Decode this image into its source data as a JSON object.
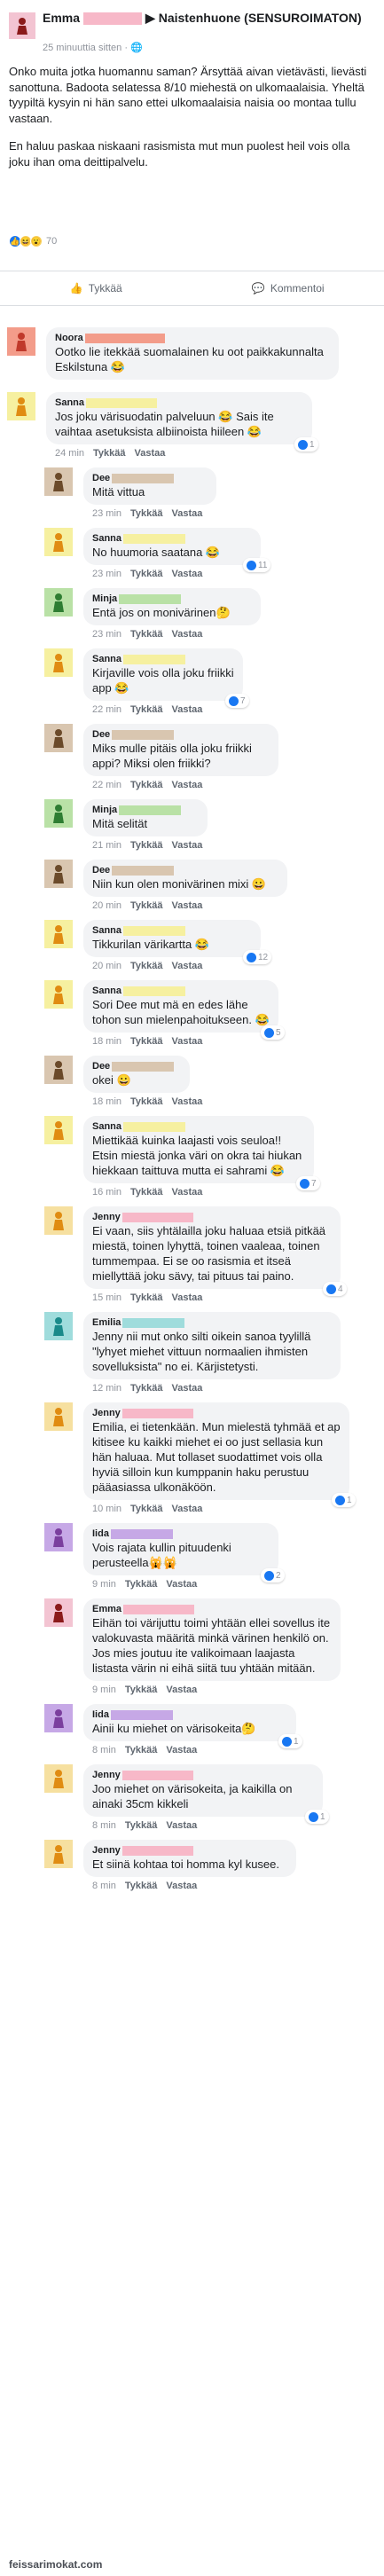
{
  "post": {
    "author": "Emma",
    "group": "Naistenhuone (SENSUROIMATON)",
    "time": "25 minuuttia sitten",
    "paragraphs": [
      "Onko muita jotka huomannu saman? Ärsyttää aivan vietävästi, lievästi sanottuna. Badoota selatessa 8/10 miehestä on ulkomaalaisia. Yheltä tyypiltä kysyin ni hän sano ettei ulkomaalaisia naisia oo montaa tullu vastaan.",
      "En haluu paskaa niskaani rasismista mut mun puolest heil vois olla joku ihan oma deittipalvelu."
    ],
    "reaction_count": "70",
    "like_label": "Tykkää",
    "comment_label": "Kommentoi"
  },
  "meta_like": "Tykkää",
  "meta_reply": "Vastaa",
  "comments": [
    {
      "name": "Noora",
      "text": "Ootko lie itekkää suomalainen ku oot paikkakunnalta Eskilstuna 😂",
      "time": "",
      "reactions": ""
    },
    {
      "name": "Sanna",
      "text": "Jos joku värisuodatin palveluun 😂 Sais ite vaihtaa asetuksista albiinoista hiileen 😂",
      "time": "24 min",
      "reactions": "1"
    },
    {
      "name": "Dee",
      "text": "Mitä vittua",
      "time": "23 min",
      "reactions": ""
    },
    {
      "name": "Sanna",
      "text": "No huumoria saatana 😂",
      "time": "23 min",
      "reactions": "11"
    },
    {
      "name": "Minja",
      "text": "Entä jos on monivärinen🤔",
      "time": "23 min",
      "reactions": ""
    },
    {
      "name": "Sanna",
      "text": "Kirjaville vois olla joku friikki app 😂",
      "time": "22 min",
      "reactions": "7"
    },
    {
      "name": "Dee",
      "text": "Miks mulle pitäis olla joku friikki appi? Miksi olen friikki?",
      "time": "22 min",
      "reactions": ""
    },
    {
      "name": "Minja",
      "text": "Mitä selität",
      "time": "21 min",
      "reactions": ""
    },
    {
      "name": "Dee",
      "text": "Niin kun olen monivärinen mixi 😀",
      "time": "20 min",
      "reactions": ""
    },
    {
      "name": "Sanna",
      "text": "Tikkurilan värikartta 😂",
      "time": "20 min",
      "reactions": "12"
    },
    {
      "name": "Sanna",
      "mention": "Dee",
      "text": "Sori Dee mut mä en edes lähe tohon sun mielenpahoitukseen. 😂",
      "time": "18 min",
      "reactions": "5"
    },
    {
      "name": "Dee",
      "text": "okei 😀",
      "time": "18 min",
      "reactions": ""
    },
    {
      "name": "Sanna",
      "text": "Miettikää kuinka laajasti vois seuloa!! Etsin miestä jonka väri on okra tai hiukan hiekkaan taittuva mutta ei sahrami 😂",
      "time": "16 min",
      "reactions": "7"
    },
    {
      "name": "Jenny",
      "text": "Ei vaan, siis yhtälailla joku haluaa etsiä pitkää miestä, toinen lyhyttä, toinen vaaleaa, toinen tummempaa. Ei se oo rasismia et itseä miellyttää joku sävy, tai pituus tai paino.",
      "time": "15 min",
      "reactions": "4"
    },
    {
      "name": "Emilia",
      "mention": "Jenny",
      "text": "Jenny nii mut onko silti oikein sanoa tyylillä \"lyhyet miehet vittuun normaalien ihmisten sovelluksista\" no ei. Kärjistetysti.",
      "time": "12 min",
      "reactions": ""
    },
    {
      "name": "Jenny",
      "mention": "Emilia",
      "text": "Emilia, ei tietenkään. Mun mielestä tyhmää et ap kitisee ku kaikki miehet ei oo just sellasia kun hän haluaa. Mut tollaset suodattimet vois olla hyviä silloin kun kumppanin haku perustuu pääasiassa ulkonäköön.",
      "time": "10 min",
      "reactions": "1"
    },
    {
      "name": "Iida",
      "text": "Vois rajata kullin pituudenki perusteella🙀🙀",
      "time": "9 min",
      "reactions": "2"
    },
    {
      "name": "Emma",
      "text": "Eihän toi värijuttu toimi yhtään ellei sovellus ite valokuvasta määritä minkä värinen henkilö on. Jos mies joutuu ite valikoimaan laajasta listasta värin ni eihä siitä tuu yhtään mitään.",
      "time": "9 min",
      "reactions": ""
    },
    {
      "name": "Iida",
      "text": "Ainii ku miehet on värisokeita🤔",
      "time": "8 min",
      "reactions": "1"
    },
    {
      "name": "Jenny",
      "text": "Joo miehet on värisokeita, ja kaikilla on ainaki 35cm kikkeli",
      "time": "8 min",
      "reactions": "1"
    },
    {
      "name": "Jenny",
      "text": "Et siinä kohtaa toi homma kyl kusee.",
      "time": "8 min",
      "reactions": ""
    }
  ],
  "watermark": "feissarimokat.com",
  "colors": {
    "pink": "#f7b8c8",
    "yellow": "#f6f0a0",
    "tan": "#d9c6b0",
    "green": "#b9e1a6",
    "orange": "#f39c8a",
    "teal": "#9fdcdc",
    "purple": "#c6a8e6",
    "bubble": "#f2f3f5"
  }
}
